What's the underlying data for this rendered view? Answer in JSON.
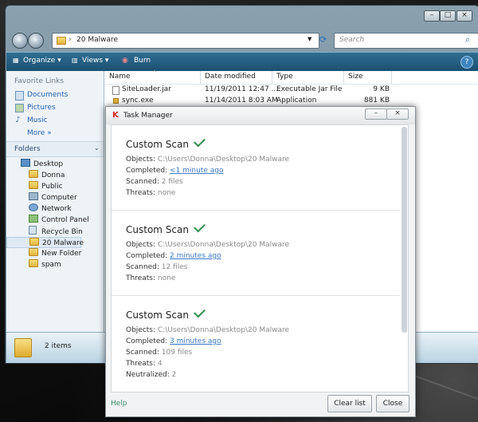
{
  "explorer": {
    "breadcrumb": "20 Malware",
    "search_placeholder": "Search",
    "toolbar": {
      "organize": "Organize",
      "views": "Views",
      "burn": "Burn"
    },
    "favorite_links_title": "Favorite Links",
    "favorite_links": [
      "Documents",
      "Pictures",
      "Music"
    ],
    "more_label": "More",
    "folders_label": "Folders",
    "tree": [
      "Desktop",
      "Donna",
      "Public",
      "Computer",
      "Network",
      "Control Panel",
      "Recycle Bin",
      "20 Malware",
      "New Folder",
      "spam"
    ],
    "columns": [
      "Name",
      "Date modified",
      "Type",
      "Size"
    ],
    "files": [
      {
        "name": "SiteLoader.jar",
        "date": "11/19/2011 12:47 ...",
        "type": "Executable Jar File",
        "size": "9 KB"
      },
      {
        "name": "sync.exe",
        "date": "11/14/2011 8:03 AM",
        "type": "Application",
        "size": "881 KB"
      }
    ],
    "details_count": "2 items"
  },
  "task_manager": {
    "title": "Task Manager",
    "scans": [
      {
        "title": "Custom Scan",
        "objects_label": "Objects:",
        "objects": "C:\\Users\\Donna\\Desktop\\20 Malware",
        "completed_label": "Completed:",
        "completed": "<1 minute ago",
        "scanned_label": "Scanned:",
        "scanned": "2 files",
        "threats_label": "Threats:",
        "threats": "none"
      },
      {
        "title": "Custom Scan",
        "objects_label": "Objects:",
        "objects": "C:\\Users\\Donna\\Desktop\\20 Malware",
        "completed_label": "Completed:",
        "completed": "2 minutes ago",
        "scanned_label": "Scanned:",
        "scanned": "12 files",
        "threats_label": "Threats:",
        "threats": "none"
      },
      {
        "title": "Custom Scan",
        "objects_label": "Objects:",
        "objects": "C:\\Users\\Donna\\Desktop\\20 Malware",
        "completed_label": "Completed:",
        "completed": "3 minutes ago",
        "scanned_label": "Scanned:",
        "scanned": "109 files",
        "threats_label": "Threats:",
        "threats": "4",
        "neutralized_label": "Neutralized:",
        "neutralized": "2"
      }
    ],
    "help_label": "Help",
    "clear_list_label": "Clear list",
    "close_label": "Close"
  },
  "colors": {
    "toolbar": "#1a4f70",
    "accent_link": "#3b78c4",
    "check": "#2f8c4a"
  }
}
